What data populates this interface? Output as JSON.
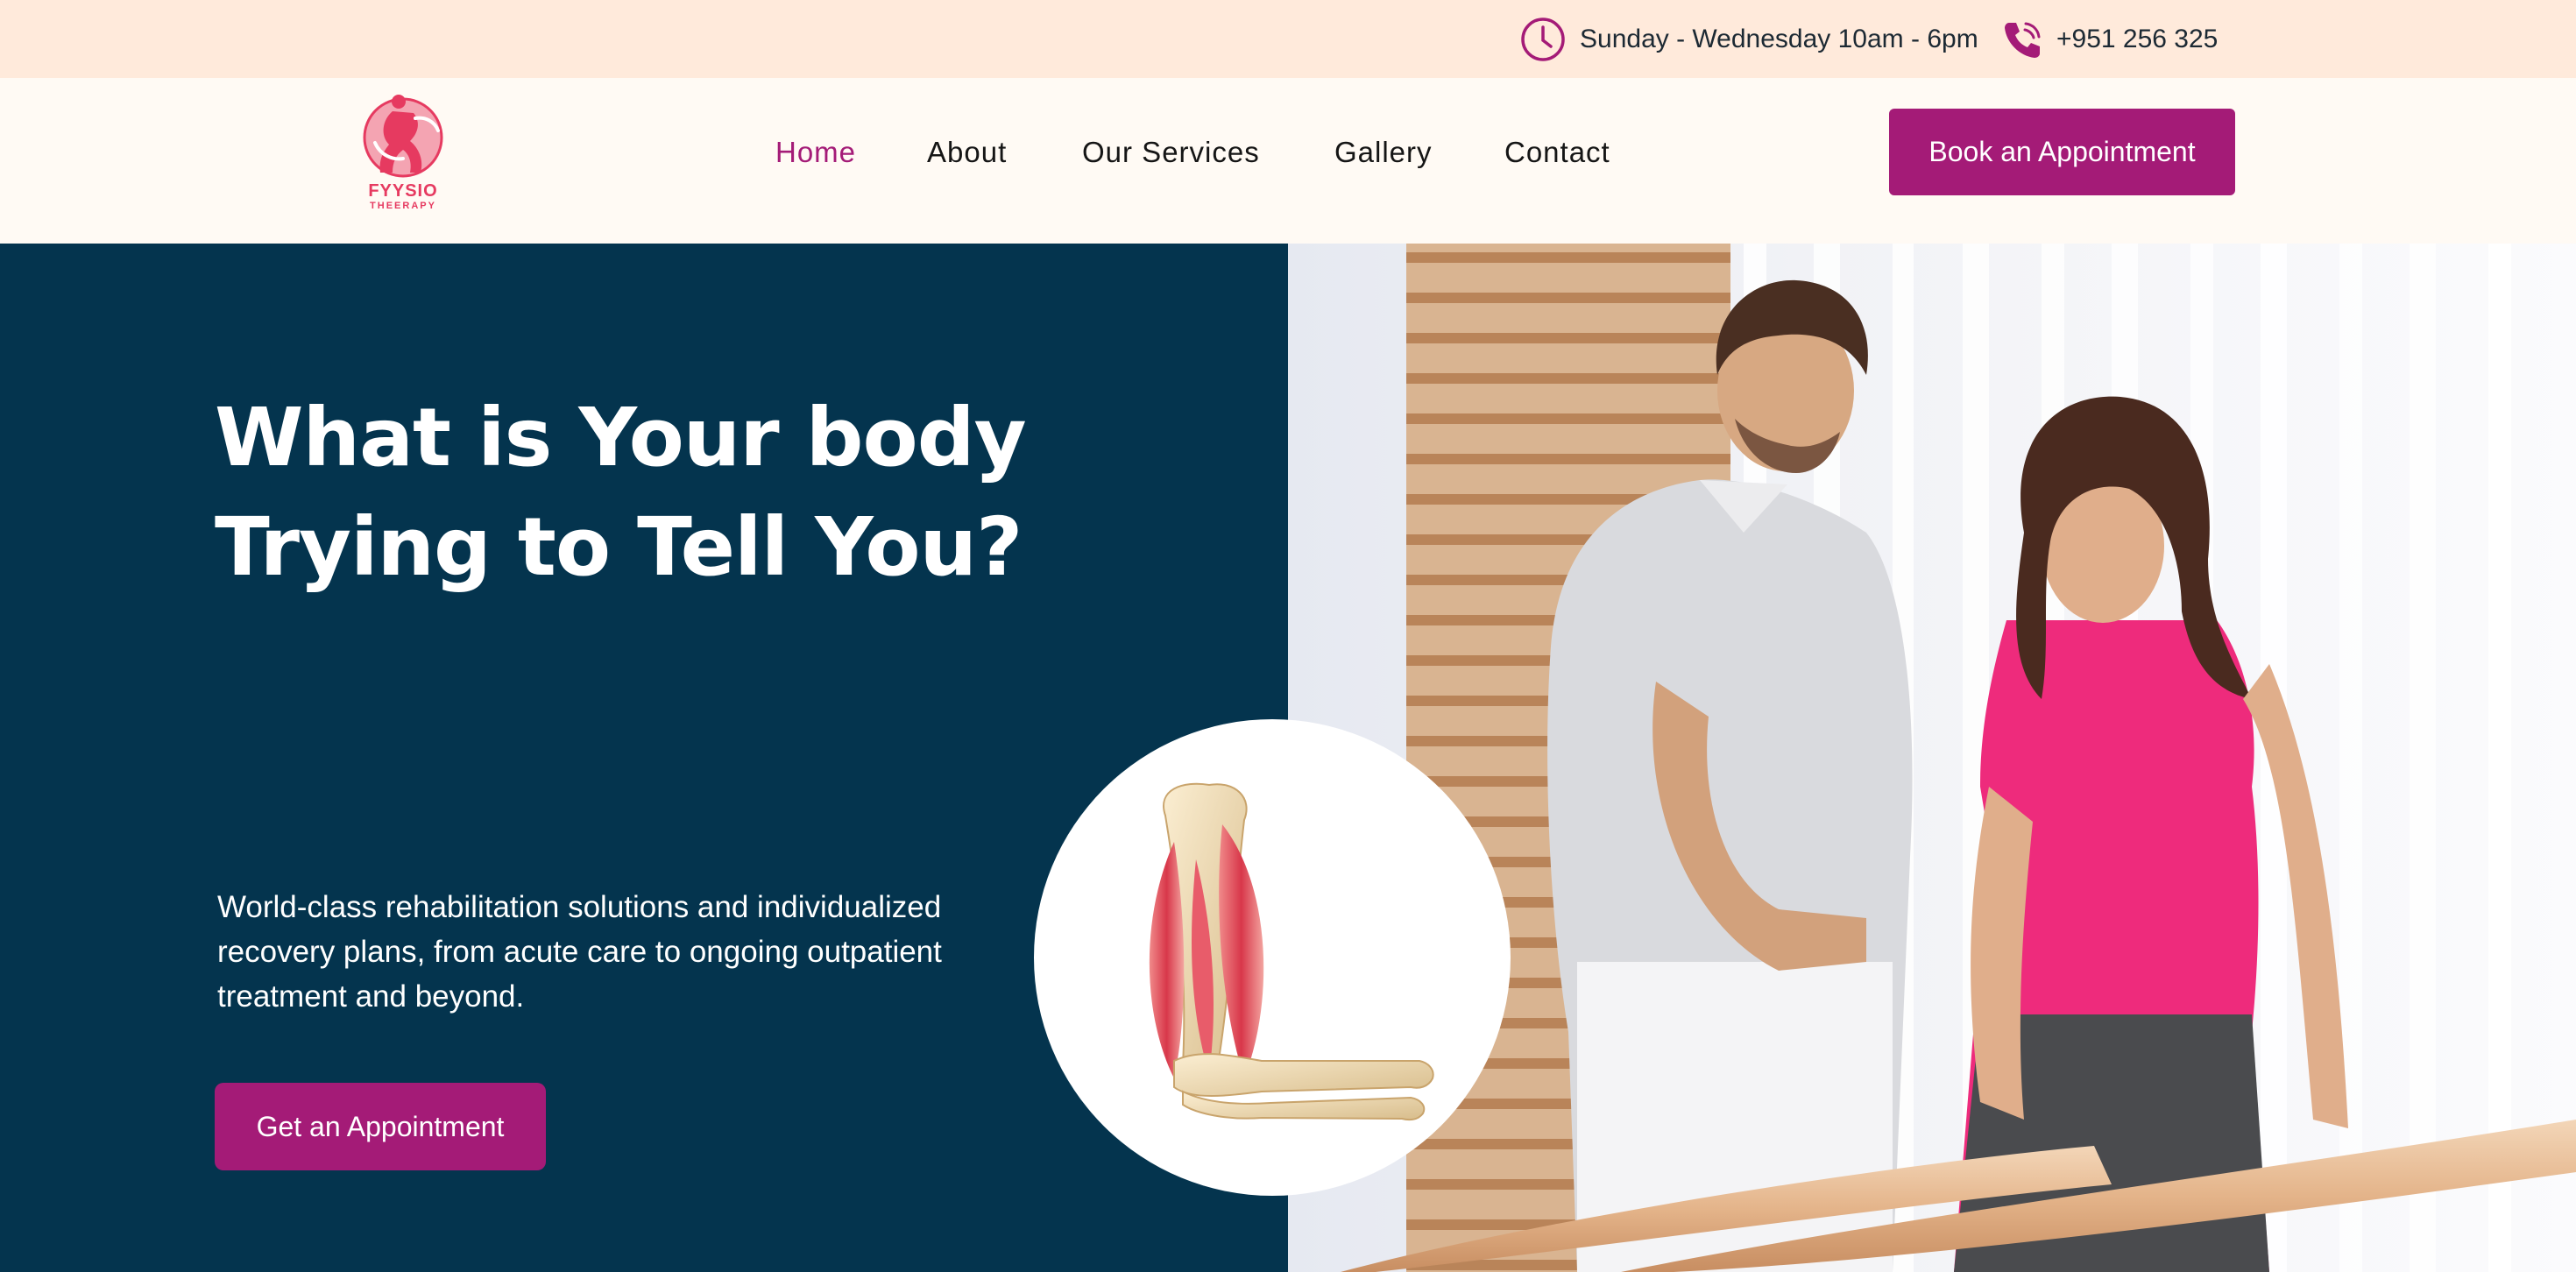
{
  "topbar": {
    "hours": "Sunday - Wednesday 10am - 6pm",
    "phone": "+951 256 325",
    "hours_icon": "clock-icon",
    "phone_icon": "phone-icon"
  },
  "logo": {
    "line1": "FYYSIO",
    "line2": "THEERAPY"
  },
  "nav": {
    "items": [
      {
        "label": "Home",
        "active": true
      },
      {
        "label": "About",
        "active": false
      },
      {
        "label": "Our Services",
        "active": false
      },
      {
        "label": "Gallery",
        "active": false
      },
      {
        "label": "Contact",
        "active": false
      }
    ],
    "book_label": "Book an Appointment"
  },
  "hero": {
    "title_line1": "What is Your body",
    "title_line2": "Trying to Tell You?",
    "description": "World-class rehabilitation solutions and individualized recovery plans, from acute care to ongoing outpatient treatment and beyond.",
    "cta_label": "Get an Appointment"
  },
  "colors": {
    "accent": "#a41b77",
    "navy": "#04344e",
    "topbar_bg": "#ffeadb",
    "header_bg": "#fffaf4",
    "logo": "#e63a60"
  }
}
